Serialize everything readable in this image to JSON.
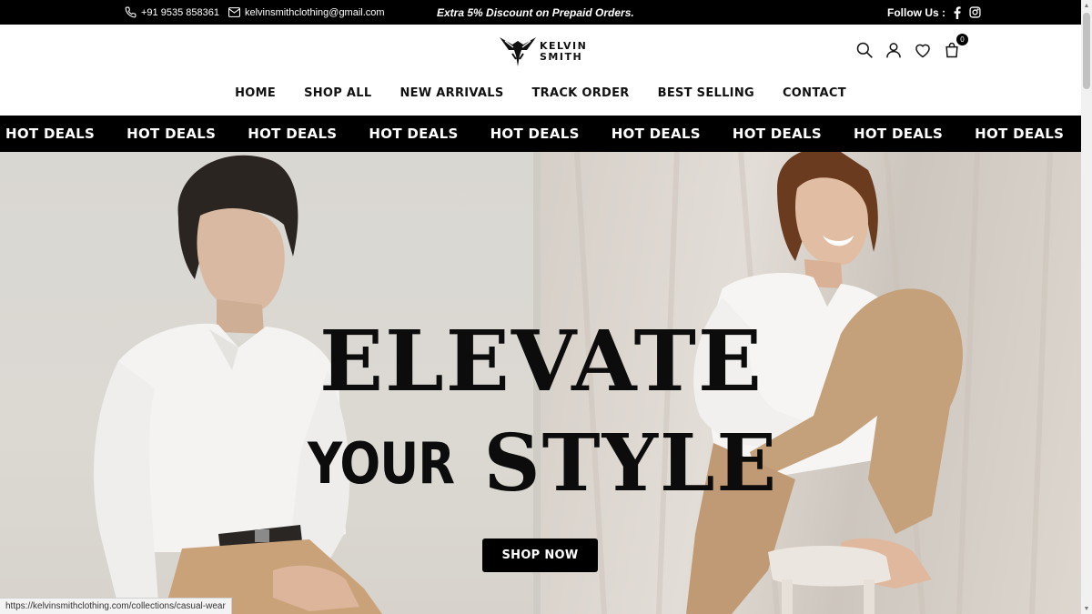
{
  "topbar": {
    "phone": "+91 9535 858361",
    "email": "kelvinsmithclothing@gmail.com",
    "promo": "Extra 5% Discount on Prepaid Orders.",
    "follow_label": "Follow Us :",
    "icons": [
      "phone-icon",
      "mail-icon",
      "facebook-icon",
      "instagram-icon"
    ]
  },
  "header": {
    "logo_line1": "KELVIN",
    "logo_line2": "SMITH",
    "cart_count": "0",
    "icons": [
      "search-icon",
      "account-icon",
      "wishlist-icon",
      "cart-icon"
    ]
  },
  "nav": {
    "items": [
      "HOME",
      "SHOP ALL",
      "NEW ARRIVALS",
      "TRACK ORDER",
      "BEST SELLING",
      "CONTACT"
    ]
  },
  "ticker": {
    "items": [
      "HOT DEALS",
      "HOT DEALS",
      "HOT DEALS",
      "HOT DEALS",
      "HOT DEALS",
      "HOT DEALS",
      "HOT DEALS",
      "HOT DEALS",
      "HOT DEALS"
    ]
  },
  "hero": {
    "headline_line1": "ELEVATE",
    "headline_your": "YOUR",
    "headline_style": "STYLE",
    "cta": "SHOP NOW"
  },
  "statusbar": {
    "url": "https://kelvinsmithclothing.com/collections/casual-wear"
  },
  "colors": {
    "bar_background": "#000000",
    "page_background": "#ffffff",
    "text_dark": "#111111"
  }
}
